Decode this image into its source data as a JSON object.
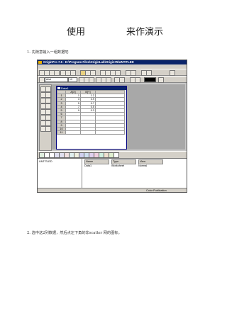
{
  "heading": {
    "left": "使用",
    "right": "来作演示"
  },
  "steps": [
    "1. 先随意输入一组数据吧",
    "2. 选中这2列数据，然后点左下角的非scatter 网的图标。"
  ],
  "app": {
    "title": "OriginPro 7.5 - D:\\Program Files\\OriginLab\\Origin75\\UNTITLED",
    "menu": [
      "File",
      "Edit",
      "View",
      "Plot",
      "Column",
      "Analysis",
      "Statistics",
      "Tools",
      "Format",
      "Window",
      "Help"
    ],
    "font_combo": "Arial",
    "size_combo": "10",
    "worksheet": {
      "title": "Data1",
      "columns": [
        "A[X]",
        "B[Y]"
      ],
      "rows": [
        {
          "n": "1",
          "a": "1",
          "b": "1.2"
        },
        {
          "n": "2",
          "a": "3",
          "b": "0.9"
        },
        {
          "n": "3",
          "a": "5",
          "b": "0.7"
        },
        {
          "n": "4",
          "a": "7",
          "b": "0.5"
        },
        {
          "n": "5",
          "a": "9",
          "b": "0.3"
        },
        {
          "n": "6",
          "a": "",
          "b": ""
        },
        {
          "n": "7",
          "a": "",
          "b": ""
        },
        {
          "n": "8",
          "a": "",
          "b": ""
        },
        {
          "n": "9",
          "a": "",
          "b": ""
        },
        {
          "n": "10",
          "a": "",
          "b": ""
        },
        {
          "n": "11",
          "a": "",
          "b": ""
        }
      ]
    },
    "explorer": {
      "tree_root": "UNTITLED",
      "headers": [
        "Name",
        "Type",
        "View"
      ],
      "item": {
        "name": "Data1",
        "type": "Worksheet",
        "view": "Normal"
      }
    },
    "status": "Color Publication"
  }
}
